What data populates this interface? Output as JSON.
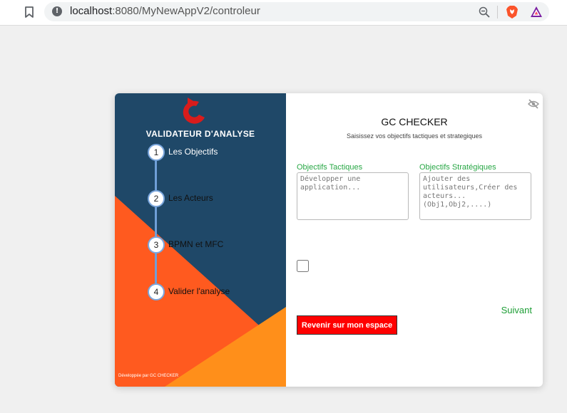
{
  "browser": {
    "url_host": "localhost",
    "url_path": ":8080/MyNewAppV2/controleur",
    "icons": {
      "bookmark": "bookmark-icon",
      "info": "info-icon",
      "zoom": "zoom-out-icon",
      "brave": "brave-shield-icon",
      "rewards": "brave-rewards-icon"
    }
  },
  "sidebar": {
    "title": "VALIDATEUR D'ANALYSE",
    "steps": [
      {
        "number": "1",
        "label": "Les Objectifs"
      },
      {
        "number": "2",
        "label": "Les Acteurs"
      },
      {
        "number": "3",
        "label": "BPMN et MFC"
      },
      {
        "number": "4",
        "label": "Valider l'analyse"
      }
    ],
    "footer_note": "Développée  par GC CHECKER",
    "colors": {
      "dark_blue": "#1f4868",
      "orange": "#ff5a1f",
      "light_orange": "#ff8f1a"
    }
  },
  "form": {
    "title": "GC CHECKER",
    "subtitle": "Saisissez vos objectifs tactiques et strategiques",
    "tactical": {
      "label": "Objectifs Tactiques",
      "placeholder": "Développer une application..."
    },
    "strategic": {
      "label": "Objectifs Stratégiques",
      "placeholder": "Ajouter des utilisateurs,Créer des acteurs...(Obj1,Obj2,....)"
    },
    "checkbox_checked": false,
    "next_label": "Suivant",
    "back_label": "Revenir sur mon espace",
    "colors": {
      "accent_green": "#28a745",
      "danger_red": "#ff0000"
    }
  }
}
